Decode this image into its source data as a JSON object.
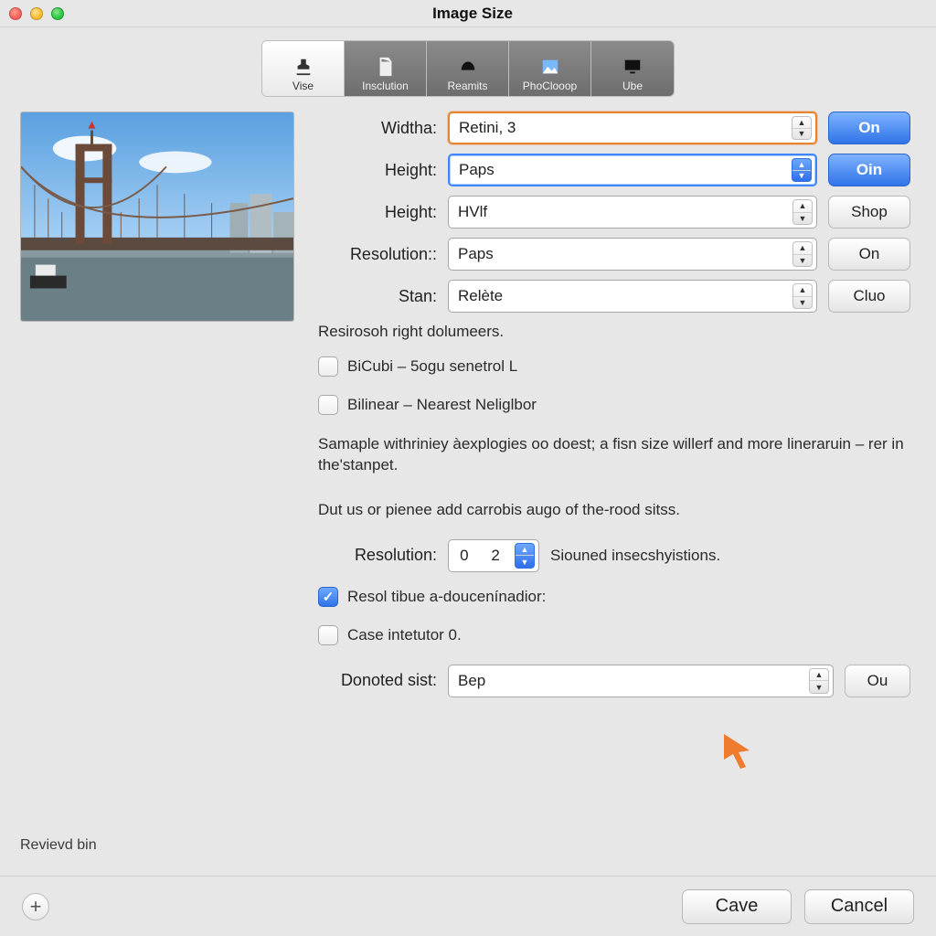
{
  "window": {
    "title": "Image Size"
  },
  "tabs": [
    {
      "label": "Vise"
    },
    {
      "label": "Insclution"
    },
    {
      "label": "Reamits"
    },
    {
      "label": "PhoClooop"
    },
    {
      "label": "Ube"
    }
  ],
  "form": {
    "rows": [
      {
        "label": "Widtha:",
        "value": "Retini, 3",
        "button": "On",
        "highlight": true,
        "primary": true
      },
      {
        "label": "Height:",
        "value": "Paps",
        "button": "Oin",
        "blue": true,
        "primary": true
      },
      {
        "label": "Height:",
        "value": "HVlf",
        "button": "Shop"
      },
      {
        "label": "Resolution::",
        "value": "Paps",
        "button": "On"
      },
      {
        "label": "Stan:",
        "value": "Relète",
        "button": "Cluo"
      }
    ],
    "hint": "Resirosoh right dolumeers.",
    "resample_options": [
      {
        "label": "BiCubi – 5ogu senetrol L",
        "checked": false
      },
      {
        "label": "Bilinear – Nearest Neliglbor",
        "checked": false
      }
    ],
    "para1": "Samaple withriniey àexplogies oo doest; a fisn size willerf and more lineraruin – rer in the'stanpet.",
    "para2": "Dut us or pienee add carrobis augo of the-rood sitss.",
    "resolution2": {
      "label": "Resolution:",
      "value": "0   2",
      "suffix": "Siouned insecshyistions."
    },
    "checks2": [
      {
        "label": "Resol tibue a-doucenínadior:",
        "checked": true
      },
      {
        "label": "Case intetutor 0.",
        "checked": false
      }
    ],
    "donated": {
      "label": "Donoted sist:",
      "value": "Bep",
      "button": "Ou"
    }
  },
  "left": {
    "reviewed": "Revievd bin"
  },
  "footer": {
    "save": "Cave",
    "cancel": "Cancel"
  }
}
